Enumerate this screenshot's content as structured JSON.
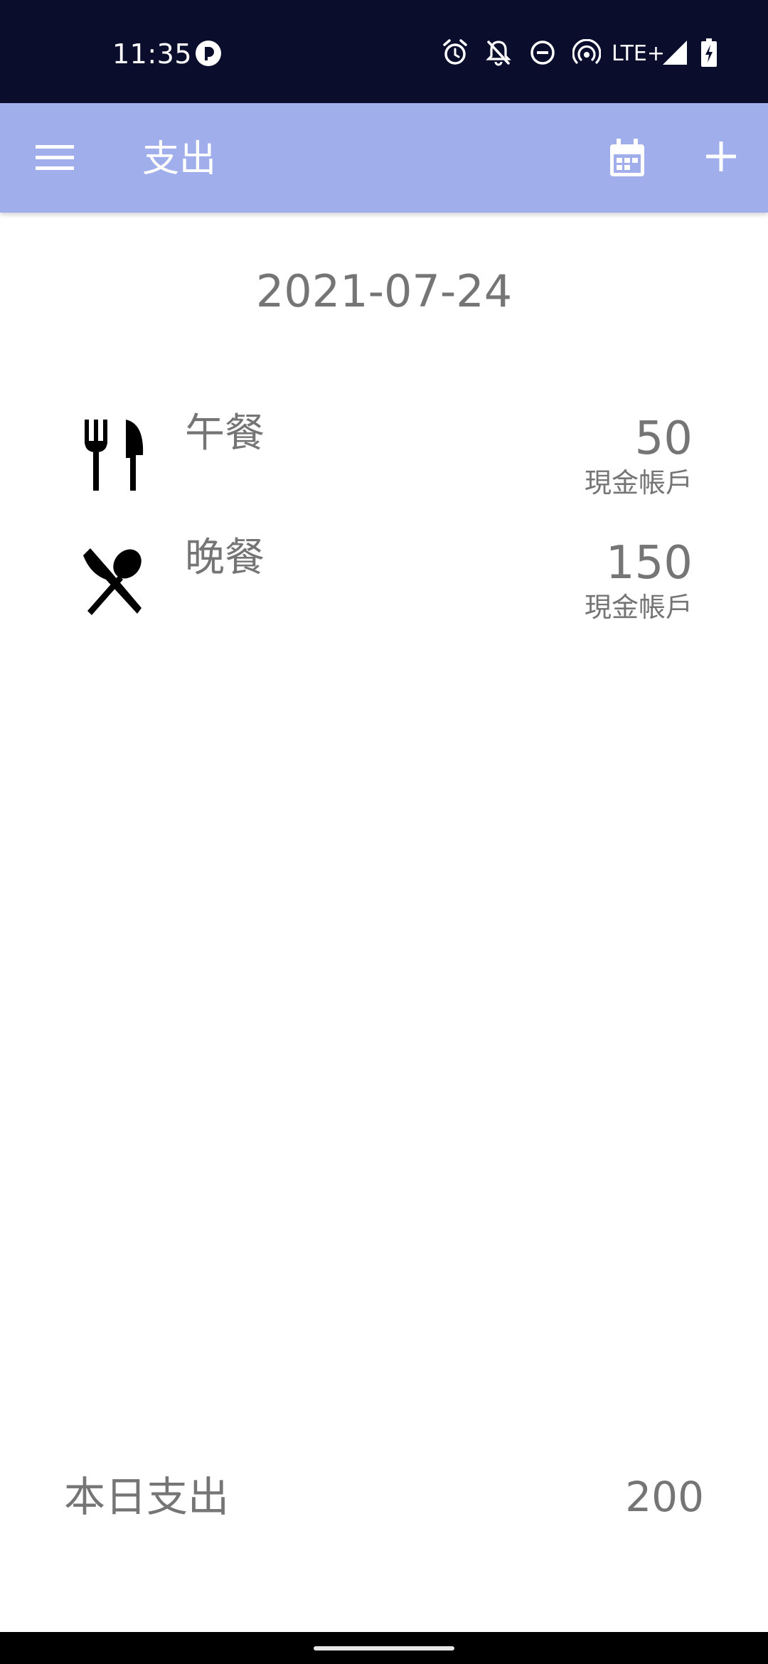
{
  "status_bar": {
    "time": "11:35",
    "network": "LTE+",
    "icons": [
      "app-notification-icon",
      "alarm-icon",
      "notifications-off-icon",
      "do-not-disturb-icon",
      "hotspot-icon",
      "signal-icon",
      "battery-charging-icon"
    ]
  },
  "app_bar": {
    "title": "支出",
    "icons": [
      "menu-icon",
      "calendar-icon",
      "add-icon"
    ],
    "background_color": "#a1aeec"
  },
  "main": {
    "date": "2021-07-24",
    "entries": [
      {
        "name": "午餐",
        "amount": "50",
        "account": "現金帳戶",
        "icon": "restaurant-icon"
      },
      {
        "name": "晚餐",
        "amount": "150",
        "account": "現金帳戶",
        "icon": "dining-icon"
      }
    ]
  },
  "footer": {
    "label": "本日支出",
    "total": "200"
  }
}
